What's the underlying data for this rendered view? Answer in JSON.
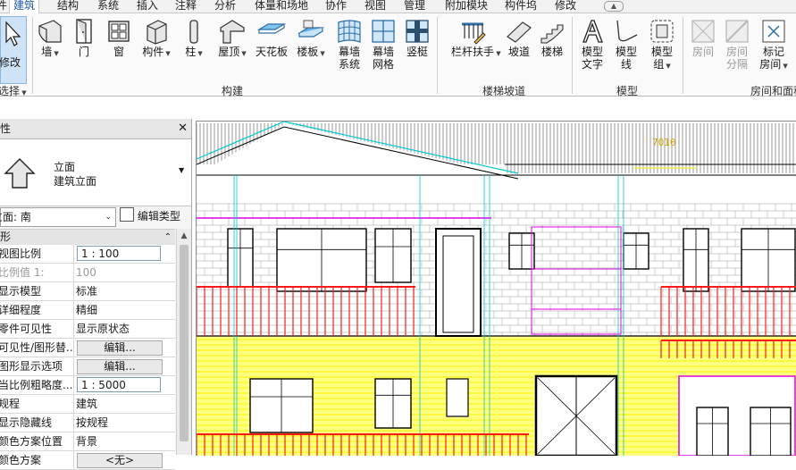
{
  "tabs": [
    "件",
    "建筑",
    "结构",
    "系统",
    "插入",
    "注释",
    "分析",
    "体量和场地",
    "协作",
    "视图",
    "管理",
    "附加模块",
    "构件坞",
    "修改"
  ],
  "active_tab": "建筑",
  "ribbon": {
    "select": {
      "modify_label": "修改",
      "group_label": "选择"
    },
    "build_tools": [
      {
        "label": "墙",
        "dropdown": true
      },
      {
        "label": "门"
      },
      {
        "label": "窗"
      },
      {
        "label": "构件",
        "dropdown": true
      },
      {
        "label": "柱",
        "dropdown": true
      },
      {
        "label": "屋顶",
        "dropdown": true
      },
      {
        "label": "天花板"
      },
      {
        "label": "楼板",
        "dropdown": true
      },
      {
        "label": "幕墙\n系统"
      },
      {
        "label": "幕墙\n网格"
      },
      {
        "label": "竖梃"
      }
    ],
    "build_group_label": "构建",
    "circulation_tools": [
      {
        "label": "栏杆扶手",
        "dropdown": true
      },
      {
        "label": "坡道"
      },
      {
        "label": "楼梯"
      }
    ],
    "circulation_group_label": "楼梯坡道",
    "model_tools": [
      {
        "label": "模型\n文字"
      },
      {
        "label": "模型\n线"
      },
      {
        "label": "模型\n组",
        "dropdown": true
      }
    ],
    "model_group_label": "模型",
    "room_tools": [
      {
        "label": "房间",
        "disabled": true
      },
      {
        "label": "房间\n分隔",
        "disabled": true
      },
      {
        "label": "标记\n房间",
        "dropdown": true
      }
    ],
    "room_group_label": "房间和面积"
  },
  "properties": {
    "title": "属性",
    "type_family": "立面",
    "type_name": "建筑立面",
    "instance": "立面: 南",
    "edit_type_label": "编辑类型",
    "group": "图形",
    "rows": [
      {
        "name": "视图比例",
        "value": "1 : 100",
        "kind": "box"
      },
      {
        "name": "比例值 1:",
        "value": "100",
        "kind": "disabled"
      },
      {
        "name": "显示模型",
        "value": "标准"
      },
      {
        "name": "详细程度",
        "value": "精细"
      },
      {
        "name": "零件可见性",
        "value": "显示原状态"
      },
      {
        "name": "可见性/图形替...",
        "value": "编辑...",
        "kind": "button"
      },
      {
        "name": "图形显示选项",
        "value": "编辑...",
        "kind": "button"
      },
      {
        "name": "当比例粗略度...",
        "value": "1 : 5000",
        "kind": "box"
      },
      {
        "name": "规程",
        "value": "建筑"
      },
      {
        "name": "显示隐藏线",
        "value": "按规程"
      },
      {
        "name": "颜色方案位置",
        "value": "背景"
      },
      {
        "name": "颜色方案",
        "value": "<无>",
        "kind": "button"
      }
    ]
  },
  "drawing": {
    "level_label": "7010",
    "colors": {
      "outline": "#000000",
      "roof_cyan": "#00c8d2",
      "magenta": "#e000e0",
      "red": "#ff1a1a",
      "yellow": "#f6f000",
      "level_text": "#d4a900"
    }
  }
}
